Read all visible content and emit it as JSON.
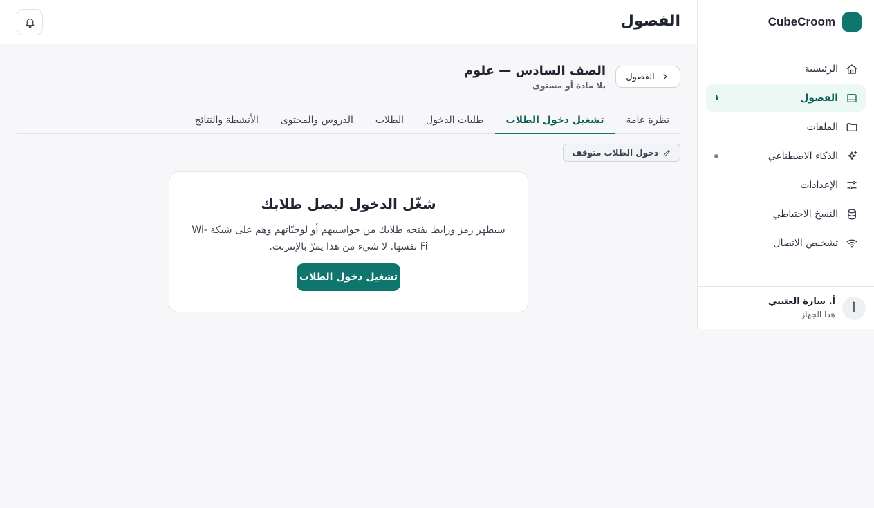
{
  "app": {
    "brand": "CubeCroom"
  },
  "header": {
    "title": "الفصول"
  },
  "sidebar": {
    "items": [
      {
        "label": "الرئيسية",
        "icon": "home-icon"
      },
      {
        "label": "الفصول",
        "icon": "book-icon",
        "badge": "١",
        "active": true
      },
      {
        "label": "الملفات",
        "icon": "folder-icon"
      },
      {
        "label": "الذكاء الاصطناعي",
        "icon": "sparkles-icon"
      },
      {
        "label": "الإعدادات",
        "icon": "sliders-icon"
      },
      {
        "label": "النسخ الاحتياطي",
        "icon": "database-icon"
      },
      {
        "label": "تشخيص الاتصال",
        "icon": "wifi-icon"
      }
    ]
  },
  "user": {
    "initial": "أ",
    "name": "أ. سارة العتيبي",
    "device": "هذا الجهاز"
  },
  "class": {
    "back_label": "الفصول",
    "title": "الصف السادس — علوم",
    "subtitle": "بلا مادة أو مستوى"
  },
  "tabs": [
    {
      "label": "نظرة عامة"
    },
    {
      "label": "تشغيل دخول الطلاب",
      "active": true
    },
    {
      "label": "طلبات الدخول"
    },
    {
      "label": "الطلاب"
    },
    {
      "label": "الدروس والمحتوى"
    },
    {
      "label": "الأنشطة والنتائج"
    }
  ],
  "status_chip": {
    "label": "دخول الطلاب متوقف"
  },
  "card": {
    "title": "شغّل الدخول ليصل طلابك",
    "description": "سيظهر رمز ورابط يفتحه طلابك من حواسيبهم أو لوحيّاتهم وهم على شبكة Wi-Fi نفسها. لا شيء من هذا يمرّ بالإنترنت.",
    "button": "تشغيل دخول الطلاب"
  },
  "colors": {
    "accent": "#0f766e",
    "accent_soft": "#ecf8f4",
    "background": "#f7f7f9"
  }
}
